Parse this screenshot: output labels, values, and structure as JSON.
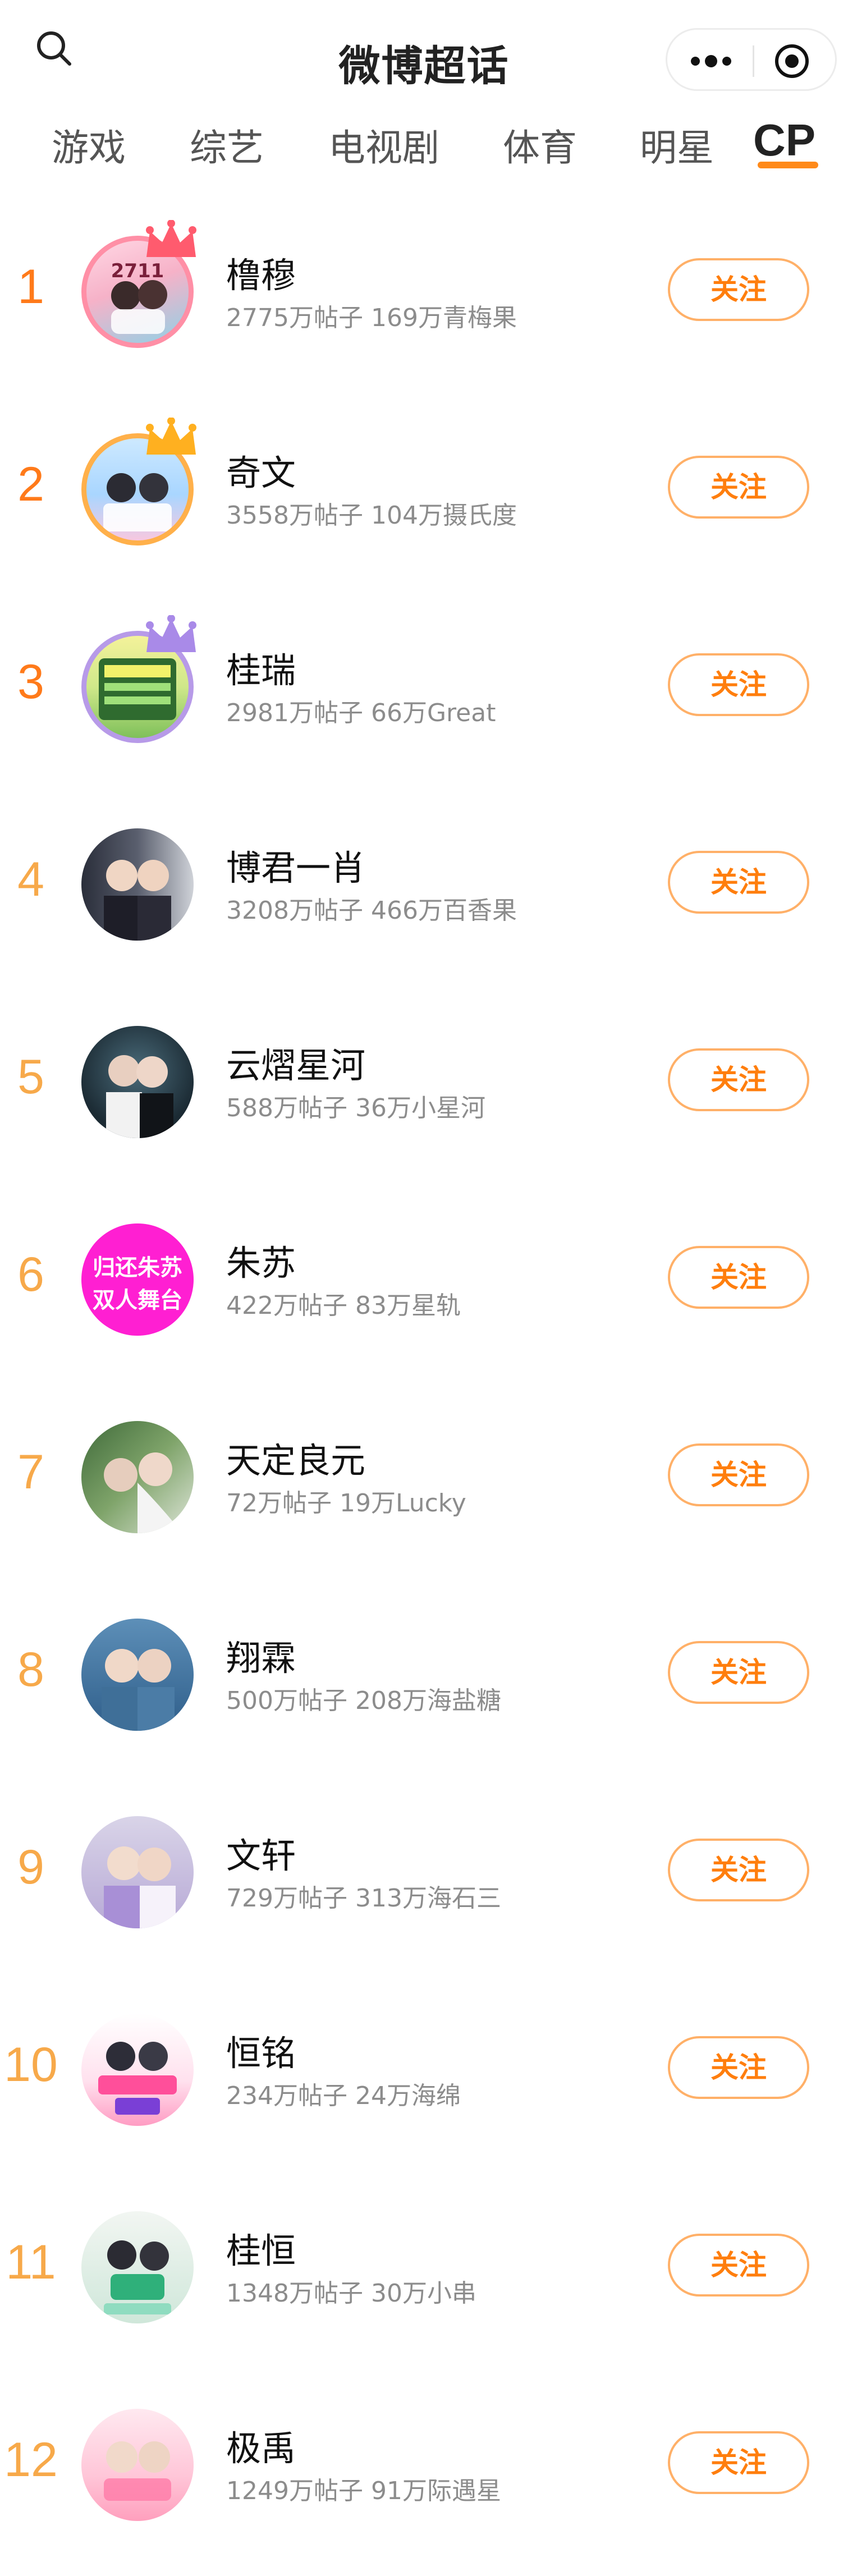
{
  "header": {
    "title": "微博超话"
  },
  "tabs": [
    {
      "label": "游戏"
    },
    {
      "label": "综艺"
    },
    {
      "label": "电视剧"
    },
    {
      "label": "体育"
    },
    {
      "label": "明星"
    },
    {
      "label": "CP"
    }
  ],
  "active_tab": "CP",
  "colors": {
    "accent": "#ff8a1a",
    "rank_top": "#ff7a1a",
    "rank_other": "#f7a94a",
    "follow_border": "#ffb068",
    "follow_text": "#ff7e0d"
  },
  "list": [
    {
      "rank": "1",
      "name": "橹穆",
      "meta": "2775万帖子 169万青梅果",
      "follow": "关注",
      "avatar_text": "2711"
    },
    {
      "rank": "2",
      "name": "奇文",
      "meta": "3558万帖子 104万摄氏度",
      "follow": "关注"
    },
    {
      "rank": "3",
      "name": "桂瑞",
      "meta": "2981万帖子 66万Great",
      "follow": "关注"
    },
    {
      "rank": "4",
      "name": "博君一肖",
      "meta": "3208万帖子 466万百香果",
      "follow": "关注"
    },
    {
      "rank": "5",
      "name": "云熠星河",
      "meta": "588万帖子 36万小星河",
      "follow": "关注"
    },
    {
      "rank": "6",
      "name": "朱苏",
      "meta": "422万帖子 83万星轨",
      "follow": "关注",
      "avatar_line1": "归还朱苏",
      "avatar_line2": "双人舞台"
    },
    {
      "rank": "7",
      "name": "天定良元",
      "meta": "72万帖子 19万Lucky",
      "follow": "关注"
    },
    {
      "rank": "8",
      "name": "翔霖",
      "meta": "500万帖子 208万海盐糖",
      "follow": "关注"
    },
    {
      "rank": "9",
      "name": "文轩",
      "meta": "729万帖子 313万海石三",
      "follow": "关注"
    },
    {
      "rank": "10",
      "name": "恒铭",
      "meta": "234万帖子 24万海绵",
      "follow": "关注"
    },
    {
      "rank": "11",
      "name": "桂恒",
      "meta": "1348万帖子 30万小串",
      "follow": "关注"
    },
    {
      "rank": "12",
      "name": "极禹",
      "meta": "1249万帖子 91万际遇星",
      "follow": "关注"
    }
  ]
}
